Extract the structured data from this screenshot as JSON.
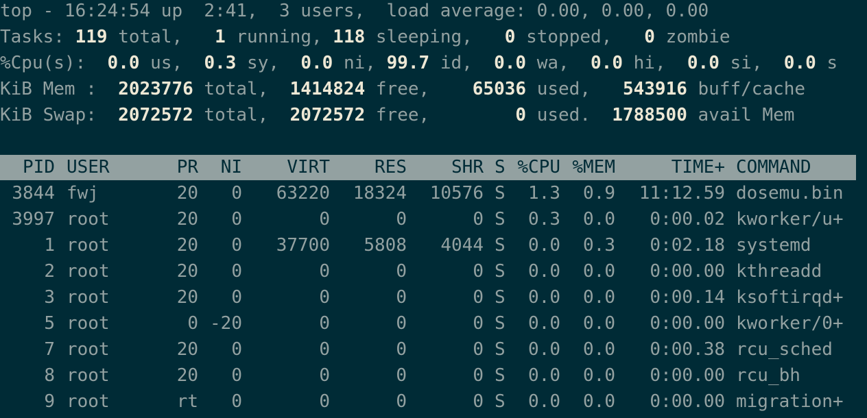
{
  "summary": {
    "line1": "top - 16:24:54 up  2:41,  3 users,  load average: 0.00, 0.00, 0.00",
    "tasks": {
      "label": "Tasks: ",
      "total": "119",
      "total_label": " total,   ",
      "running": "1",
      "running_label": " running, ",
      "sleeping": "118",
      "sleeping_label": " sleeping,   ",
      "stopped": "0",
      "stopped_label": " stopped,   ",
      "zombie": "0",
      "zombie_label": " zombie"
    },
    "cpu": {
      "label": "%Cpu(s):  ",
      "us": "0.0",
      "us_label": " us,  ",
      "sy": "0.3",
      "sy_label": " sy,  ",
      "ni": "0.0",
      "ni_label": " ni, ",
      "id": "99.7",
      "id_label": " id,  ",
      "wa": "0.0",
      "wa_label": " wa,  ",
      "hi": "0.0",
      "hi_label": " hi,  ",
      "si": "0.0",
      "si_label": " si,  ",
      "st": "0.0",
      "st_label": " s"
    },
    "mem": {
      "label": "KiB Mem :  ",
      "total": "2023776",
      "total_label": " total,  ",
      "free": "1414824",
      "free_label": " free,    ",
      "used": "65036",
      "used_label": " used,   ",
      "buff": "543916",
      "buff_label": " buff/cache"
    },
    "swap": {
      "label": "KiB Swap:  ",
      "total": "2072572",
      "total_label": " total,  ",
      "free": "2072572",
      "free_label": " free,        ",
      "used": "0",
      "used_label": " used.  ",
      "avail": "1788500",
      "avail_label": " avail Mem"
    }
  },
  "columns": {
    "pid": "PID",
    "user": "USER",
    "pr": "PR",
    "ni": "NI",
    "virt": "VIRT",
    "res": "RES",
    "shr": "SHR",
    "s": "S",
    "cpu": "%CPU",
    "mem": "%MEM",
    "time": "TIME+",
    "command": "COMMAND"
  },
  "processes": [
    {
      "pid": "3844",
      "user": "fwj",
      "pr": "20",
      "ni": "0",
      "virt": "63220",
      "res": "18324",
      "shr": "10576",
      "s": "S",
      "cpu": "1.3",
      "mem": "0.9",
      "time": "11:12.59",
      "command": "dosemu.bin"
    },
    {
      "pid": "3997",
      "user": "root",
      "pr": "20",
      "ni": "0",
      "virt": "0",
      "res": "0",
      "shr": "0",
      "s": "S",
      "cpu": "0.3",
      "mem": "0.0",
      "time": "0:00.02",
      "command": "kworker/u+"
    },
    {
      "pid": "1",
      "user": "root",
      "pr": "20",
      "ni": "0",
      "virt": "37700",
      "res": "5808",
      "shr": "4044",
      "s": "S",
      "cpu": "0.0",
      "mem": "0.3",
      "time": "0:02.18",
      "command": "systemd"
    },
    {
      "pid": "2",
      "user": "root",
      "pr": "20",
      "ni": "0",
      "virt": "0",
      "res": "0",
      "shr": "0",
      "s": "S",
      "cpu": "0.0",
      "mem": "0.0",
      "time": "0:00.00",
      "command": "kthreadd"
    },
    {
      "pid": "3",
      "user": "root",
      "pr": "20",
      "ni": "0",
      "virt": "0",
      "res": "0",
      "shr": "0",
      "s": "S",
      "cpu": "0.0",
      "mem": "0.0",
      "time": "0:00.14",
      "command": "ksoftirqd+"
    },
    {
      "pid": "5",
      "user": "root",
      "pr": "0",
      "ni": "-20",
      "virt": "0",
      "res": "0",
      "shr": "0",
      "s": "S",
      "cpu": "0.0",
      "mem": "0.0",
      "time": "0:00.00",
      "command": "kworker/0+"
    },
    {
      "pid": "7",
      "user": "root",
      "pr": "20",
      "ni": "0",
      "virt": "0",
      "res": "0",
      "shr": "0",
      "s": "S",
      "cpu": "0.0",
      "mem": "0.0",
      "time": "0:00.38",
      "command": "rcu_sched"
    },
    {
      "pid": "8",
      "user": "root",
      "pr": "20",
      "ni": "0",
      "virt": "0",
      "res": "0",
      "shr": "0",
      "s": "S",
      "cpu": "0.0",
      "mem": "0.0",
      "time": "0:00.00",
      "command": "rcu_bh"
    },
    {
      "pid": "9",
      "user": "root",
      "pr": "rt",
      "ni": "0",
      "virt": "0",
      "res": "0",
      "shr": "0",
      "s": "S",
      "cpu": "0.0",
      "mem": "0.0",
      "time": "0:00.00",
      "command": "migration+"
    }
  ],
  "colors": {
    "background": "#002b36",
    "text": "#93a1a1",
    "bold_text": "#eee8d5",
    "header_bar": "#93a1a1"
  }
}
